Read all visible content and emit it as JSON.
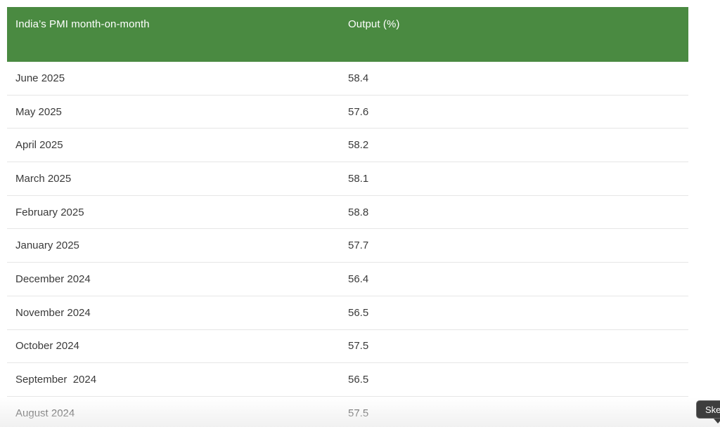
{
  "table": {
    "headers": {
      "col1": "India’s PMI month-on-month",
      "col2": "Output (%)"
    },
    "rows": [
      {
        "month": "June 2025",
        "output": "58.4"
      },
      {
        "month": "May 2025",
        "output": "57.6"
      },
      {
        "month": "April 2025",
        "output": "58.2"
      },
      {
        "month": "March 2025",
        "output": "58.1"
      },
      {
        "month": "February 2025",
        "output": "58.8"
      },
      {
        "month": "January 2025",
        "output": "57.7"
      },
      {
        "month": "December 2024",
        "output": "56.4"
      },
      {
        "month": "November 2024",
        "output": "56.5"
      },
      {
        "month": "October 2024",
        "output": "57.5"
      },
      {
        "month": "September  2024",
        "output": "56.5"
      },
      {
        "month": "August 2024",
        "output": "57.5"
      }
    ]
  },
  "tooltip": {
    "text": "Ske"
  },
  "colors": {
    "header_bg": "#4a8a41",
    "header_text": "#ffffff",
    "row_text": "#3a3a3a",
    "row_border": "#e6e6e6"
  }
}
